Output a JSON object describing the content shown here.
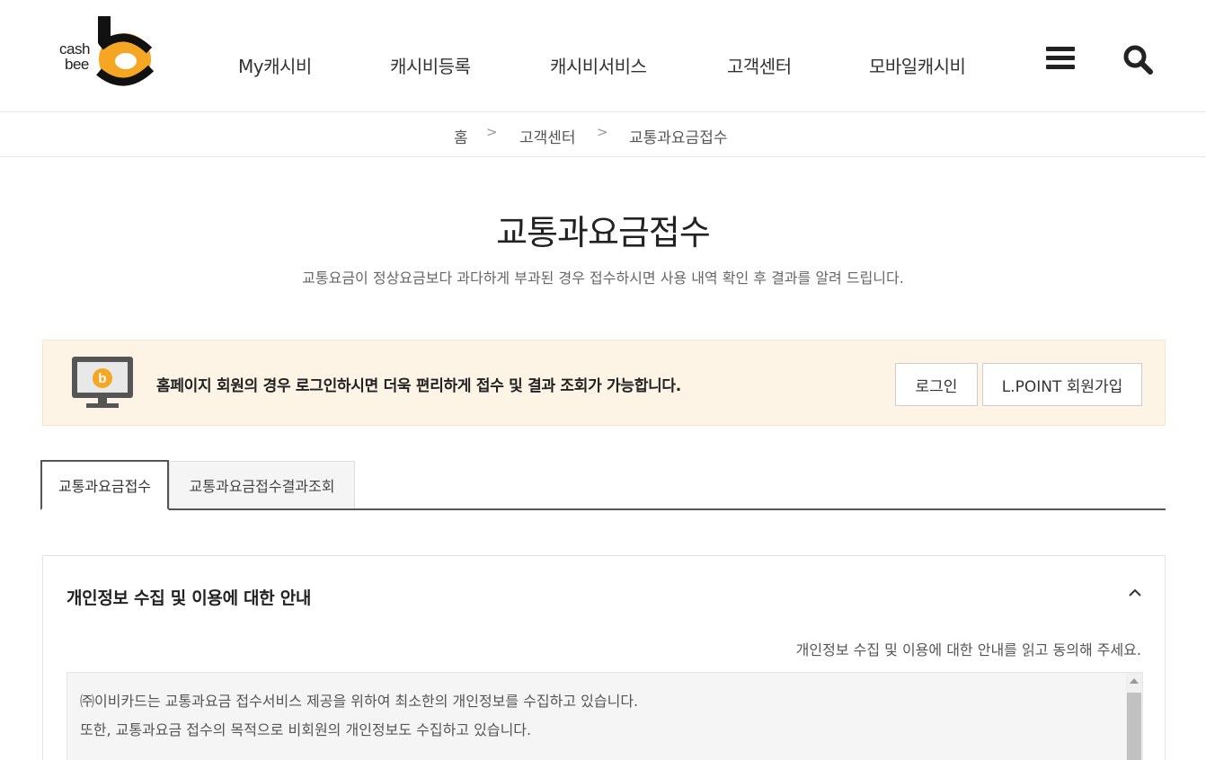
{
  "header": {
    "logo": {
      "line1": "cash",
      "line2": "bee",
      "brand_color": "#f5a623"
    },
    "nav": [
      {
        "label": "My캐시비"
      },
      {
        "label": "캐시비등록"
      },
      {
        "label": "캐시비서비스"
      },
      {
        "label": "고객센터"
      },
      {
        "label": "모바일캐시비"
      }
    ],
    "menu_icon": "hamburger-menu-icon",
    "search_icon": "search-icon"
  },
  "breadcrumb": {
    "items": [
      "홈",
      "고객센터",
      "교통과요금접수"
    ],
    "separator": ">"
  },
  "page": {
    "title": "교통과요금접수",
    "description": "교통요금이 정상요금보다 과다하게 부과된 경우 접수하시면 사용 내역 확인 후 결과를 알려 드립니다."
  },
  "notice": {
    "icon": "monitor-icon",
    "text": "홈페이지 회원의 경우 로그인하시면 더욱 편리하게 접수 및 결과 조회가 가능합니다.",
    "login_button": "로그인",
    "join_button": "L.POINT 회원가입",
    "background_color": "#fdf4e5"
  },
  "tabs": [
    {
      "label": "교통과요금접수",
      "active": true
    },
    {
      "label": "교통과요금접수결과조회",
      "active": false
    }
  ],
  "privacy": {
    "title": "개인정보 수집 및 이용에 대한 안내",
    "toggle_icon": "chevron-up-icon",
    "hint": "개인정보 수집 및 이용에 대한 안내를 읽고 동의해 주세요.",
    "content_lines": [
      "㈜이비카드는 교통과요금 접수서비스 제공을 위하여 최소한의 개인정보를 수집하고 있습니다.",
      "또한, 교통과요금 접수의 목적으로 비회원의 개인정보도 수집하고 있습니다."
    ]
  }
}
